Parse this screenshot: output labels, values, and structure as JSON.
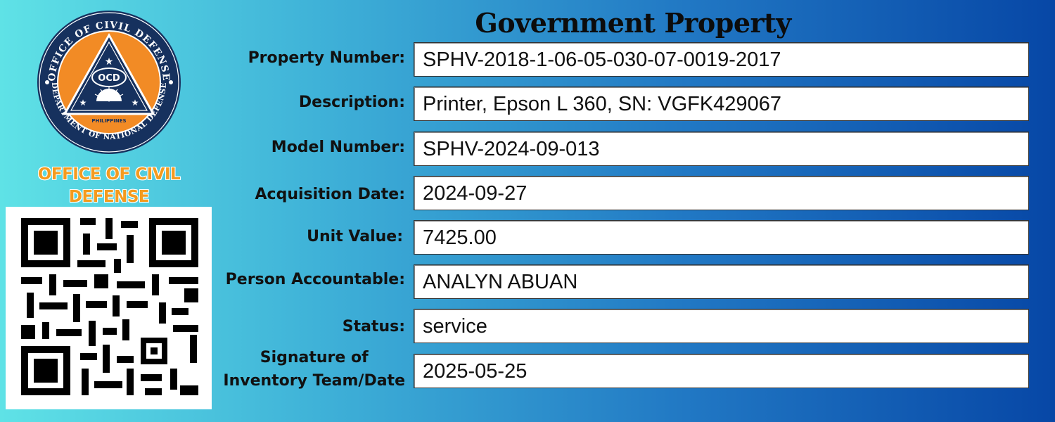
{
  "title": "Government Property",
  "logo": {
    "ring_top": "OFFICE OF CIVIL DEFENSE",
    "ring_bottom": "DEPARTMENT OF NATIONAL DEFENSE",
    "center": "OCD",
    "country": "PHILIPPINES",
    "colors": {
      "navy": "#16315e",
      "orange": "#f28b25"
    }
  },
  "org": {
    "line1": "OFFICE OF CIVIL",
    "line2": "DEFENSE"
  },
  "qr_code": {
    "icon": "qr-code-icon"
  },
  "fields": [
    {
      "label": "Property Number:",
      "value": "SPHV-2018-1-06-05-030-07-0019-2017"
    },
    {
      "label": "Description:",
      "value": "Printer, Epson L 360, SN: VGFK429067"
    },
    {
      "label": "Model Number:",
      "value": "SPHV-2024-09-013"
    },
    {
      "label": "Acquisition Date:",
      "value": "2024-09-27"
    },
    {
      "label": "Unit Value:",
      "value": "7425.00"
    },
    {
      "label": "Person Accountable:",
      "value": "ANALYN ABUAN"
    },
    {
      "label": "Status:",
      "value": "service"
    },
    {
      "label_line1": "Signature of",
      "label_line2": "Inventory Team/Date",
      "value": "2025-05-25"
    }
  ]
}
